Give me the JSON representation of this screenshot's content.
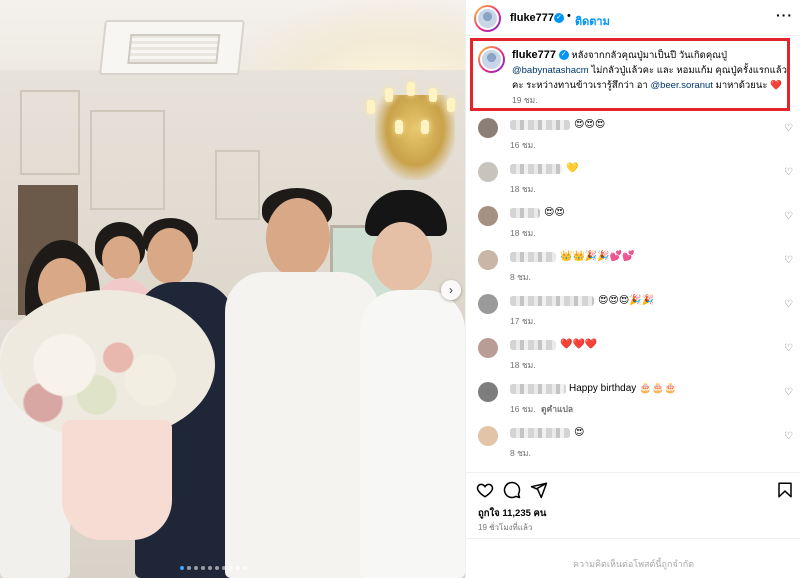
{
  "post": {
    "username": "fluke777",
    "verified_mark": "✓",
    "separator": "•",
    "follow_label": "ติดตาม",
    "more_icon": "···"
  },
  "caption": {
    "username": "fluke777",
    "line1": "หลังจากกลัวคุณปู่มาเป็นปี วันเกิดคุณปู่",
    "mention1": "@babynatashacm",
    "line2": "ไม่กลัวปู่แล้วคะ และ หอมแก้ม คุณปู่ครั้งแรกแล้วคะ ระหว่างทานข้าวเรารู้สึกว่า อา",
    "mention2": "@beer.soranut",
    "line3": "มาหาด้วยนะ",
    "heart": "❤️",
    "time": "19 ชม."
  },
  "comments": [
    {
      "text": "😍😍😍",
      "time": "16 ชม.",
      "avatar_color": "#8c7f78"
    },
    {
      "text": "💛",
      "time": "18 ชม.",
      "avatar_color": "#c9c3bd"
    },
    {
      "text": "😍😍",
      "time": "18 ชม.",
      "avatar_color": "#a88f84"
    },
    {
      "text": "👑👑🎉🎉💕💕",
      "time": "8 ชม.",
      "avatar_color": "#c9b6a6"
    },
    {
      "text": "😍😍😍🎉🎉",
      "time": "17 ชม.",
      "avatar_color": "#9a9a9a"
    },
    {
      "text": "❤️❤️❤️",
      "time": "18 ชม.",
      "avatar_color": "#b79d95"
    },
    {
      "text": "Happy birthday 🎂🎂🎂",
      "time": "16 ชม.",
      "reply": "ดูคำแปล",
      "avatar_color": "#7d7d7d"
    },
    {
      "text": "😍",
      "time": "8 ชม.",
      "avatar_color": "#e2c4a8"
    }
  ],
  "footer": {
    "likes": "ถูกใจ 11,235 คน",
    "posted": "19 ชั่วโมงที่แล้ว",
    "comments_closed": "ความคิดเห็นต่อโพสต์นี้ถูกจำกัด"
  },
  "icons": [
    "like-icon",
    "comment-icon",
    "share-icon",
    "save-icon",
    "comment-like-icon",
    "next-photo-icon"
  ],
  "colors": {
    "accent": "#0095f6",
    "highlight_border": "#e3242b",
    "mention": "#00376b",
    "muted": "#737373"
  }
}
